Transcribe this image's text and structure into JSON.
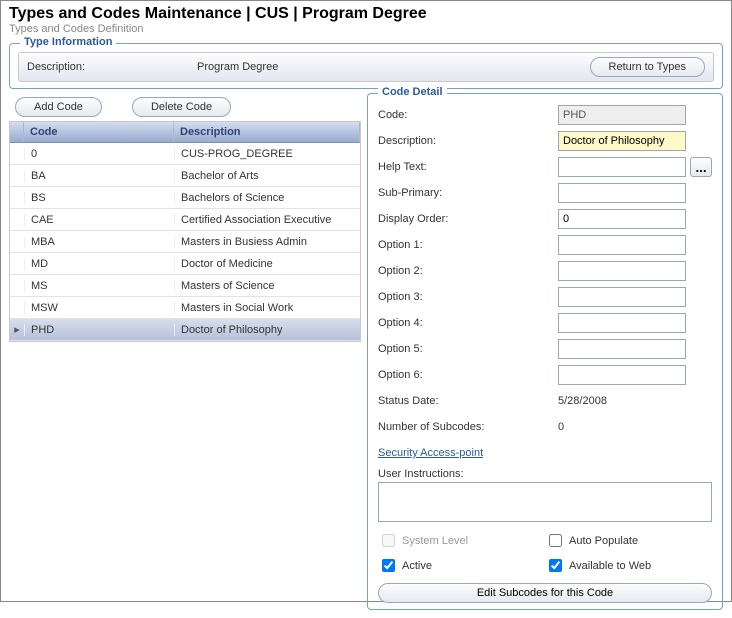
{
  "header": {
    "title": "Types and Codes Maintenance  |  CUS | Program Degree",
    "subtitle": "Types and Codes Definition"
  },
  "typeInfo": {
    "legend": "Type Information",
    "descLabel": "Description:",
    "descValue": "Program Degree",
    "returnBtn": "Return to Types"
  },
  "buttons": {
    "addCode": "Add Code",
    "deleteCode": "Delete Code"
  },
  "grid": {
    "headCode": "Code",
    "headDesc": "Description",
    "rows": [
      {
        "code": "0",
        "desc": "CUS-PROG_DEGREE",
        "sel": false
      },
      {
        "code": "BA",
        "desc": "Bachelor of Arts",
        "sel": false
      },
      {
        "code": "BS",
        "desc": "Bachelors of Science",
        "sel": false
      },
      {
        "code": "CAE",
        "desc": "Certified Association Executive",
        "sel": false
      },
      {
        "code": "MBA",
        "desc": "Masters in Busiess Admin",
        "sel": false
      },
      {
        "code": "MD",
        "desc": "Doctor of Medicine",
        "sel": false
      },
      {
        "code": "MS",
        "desc": "Masters of Science",
        "sel": false
      },
      {
        "code": "MSW",
        "desc": "Masters in Social Work",
        "sel": false
      },
      {
        "code": "PHD",
        "desc": "Doctor of Philosophy",
        "sel": true
      }
    ]
  },
  "detail": {
    "legend": "Code Detail",
    "labels": {
      "code": "Code:",
      "desc": "Description:",
      "help": "Help Text:",
      "sub": "Sub-Primary:",
      "order": "Display Order:",
      "opt1": "Option 1:",
      "opt2": "Option 2:",
      "opt3": "Option 3:",
      "opt4": "Option 4:",
      "opt5": "Option 5:",
      "opt6": "Option 6:",
      "status": "Status Date:",
      "numsub": "Number of Subcodes:",
      "sec": "Security Access-point",
      "userinst": "User Instructions:"
    },
    "values": {
      "code": "PHD",
      "desc": "Doctor of Philosophy",
      "help": "",
      "sub": "",
      "order": "0",
      "opt1": "",
      "opt2": "",
      "opt3": "",
      "opt4": "",
      "opt5": "",
      "opt6": "",
      "status": "5/28/2008",
      "numsub": "0",
      "userinst": ""
    },
    "checks": {
      "sys": {
        "label": "System Level",
        "checked": false,
        "disabled": true
      },
      "auto": {
        "label": "Auto Populate",
        "checked": false,
        "disabled": false
      },
      "active": {
        "label": "Active",
        "checked": true,
        "disabled": false
      },
      "web": {
        "label": "Available to Web",
        "checked": true,
        "disabled": false
      }
    },
    "editSubcodes": "Edit Subcodes for this Code"
  }
}
